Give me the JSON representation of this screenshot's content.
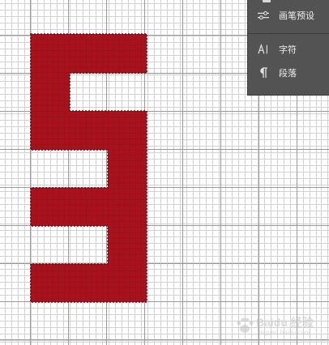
{
  "panel": {
    "items": [
      {
        "label": "画笔预设",
        "icon": "brush-presets-icon"
      },
      {
        "label": "字符",
        "icon": "character-icon"
      },
      {
        "label": "段落",
        "icon": "paragraph-icon"
      }
    ]
  },
  "shape": {
    "fill_color": "#a7121d",
    "grid_color": "#8f0f19"
  },
  "watermark": {
    "text": "Baidu 经验",
    "subtext": "jingyan.baidu.com"
  }
}
